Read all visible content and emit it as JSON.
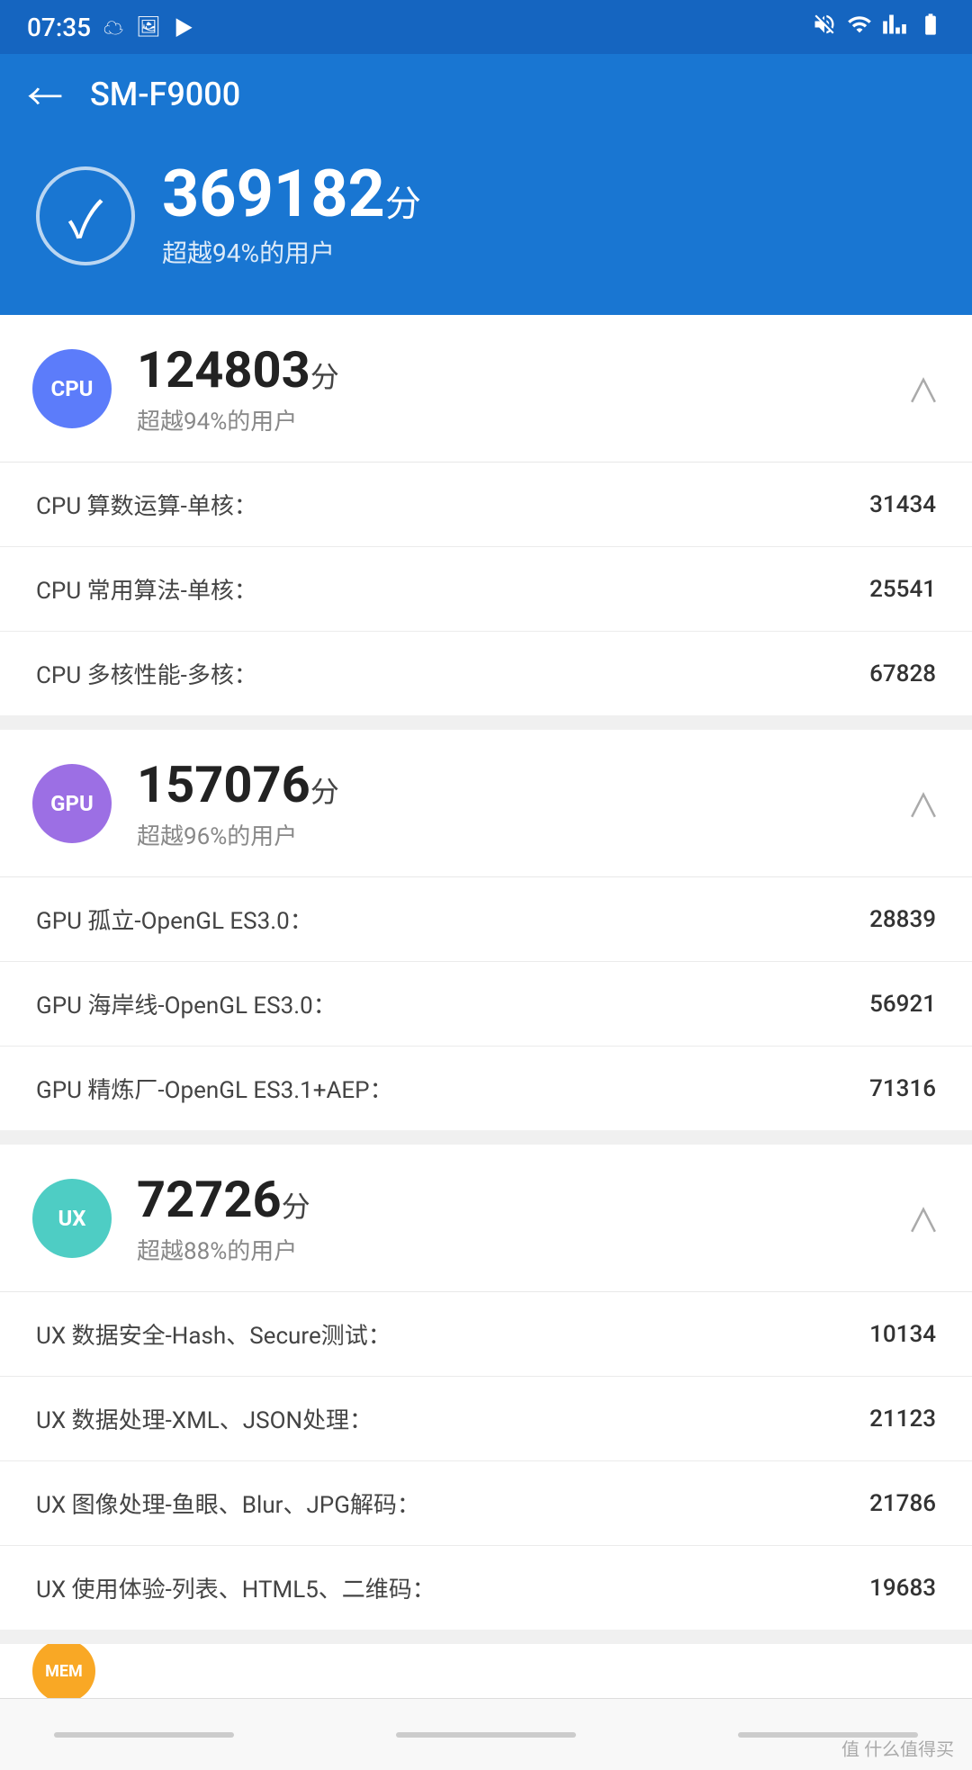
{
  "statusBar": {
    "time": "07:35",
    "leftIcons": [
      "☁",
      "🖼",
      "▶"
    ],
    "rightIcons": [
      "🔇",
      "WiFi",
      "signal",
      "🔋"
    ]
  },
  "toolbar": {
    "backLabel": "←",
    "title": "SM-F9000"
  },
  "hero": {
    "score": "369182",
    "unit": "分",
    "percentile": "超越94%的用户"
  },
  "categories": [
    {
      "id": "cpu",
      "badgeLabel": "CPU",
      "score": "124803",
      "unit": "分",
      "percentile": "超越94%的用户",
      "colorClass": "badge-cpu",
      "subItems": [
        {
          "label": "CPU 算数运算-单核：",
          "value": "31434"
        },
        {
          "label": "CPU 常用算法-单核：",
          "value": "25541"
        },
        {
          "label": "CPU 多核性能-多核：",
          "value": "67828"
        }
      ]
    },
    {
      "id": "gpu",
      "badgeLabel": "GPU",
      "score": "157076",
      "unit": "分",
      "percentile": "超越96%的用户",
      "colorClass": "badge-gpu",
      "subItems": [
        {
          "label": "GPU 孤立-OpenGL ES3.0：",
          "value": "28839"
        },
        {
          "label": "GPU 海岸线-OpenGL ES3.0：",
          "value": "56921"
        },
        {
          "label": "GPU 精炼厂-OpenGL ES3.1+AEP：",
          "value": "71316"
        }
      ]
    },
    {
      "id": "ux",
      "badgeLabel": "UX",
      "score": "72726",
      "unit": "分",
      "percentile": "超越88%的用户",
      "colorClass": "badge-ux",
      "subItems": [
        {
          "label": "UX 数据安全-Hash、Secure测试：",
          "value": "10134"
        },
        {
          "label": "UX 数据处理-XML、JSON处理：",
          "value": "21123"
        },
        {
          "label": "UX 图像处理-鱼眼、Blur、JPG解码：",
          "value": "21786"
        },
        {
          "label": "UX 使用体验-列表、HTML5、二维码：",
          "value": "19683"
        }
      ]
    }
  ],
  "partialBadge": "MEM",
  "bottomNav": {
    "watermark": "值 什么值得买"
  }
}
